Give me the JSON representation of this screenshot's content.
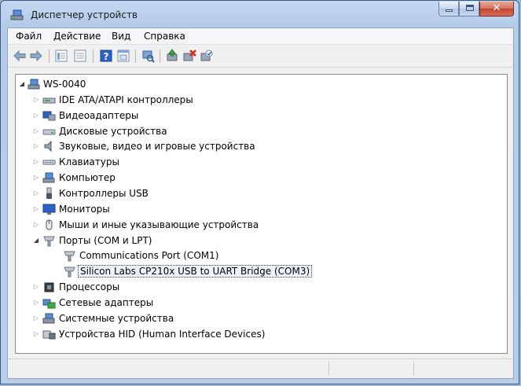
{
  "window": {
    "title": "Диспетчер устройств",
    "close_glyph": "✕"
  },
  "menu": {
    "file": "Файл",
    "action": "Действие",
    "view": "Вид",
    "help": "Справка"
  },
  "toolbar": {
    "icons": [
      "back-arrow-icon",
      "forward-arrow-icon",
      "properties-list-icon",
      "list-view-icon",
      "help-icon",
      "details-view-icon",
      "scan-hardware-icon",
      "update-driver-icon",
      "uninstall-device-icon",
      "disable-device-icon"
    ]
  },
  "tree": {
    "root": "WS-0040",
    "nodes": [
      {
        "label": "IDE ATA/ATAPI контроллеры",
        "icon": "ide-controller-icon"
      },
      {
        "label": "Видеоадаптеры",
        "icon": "display-adapter-icon"
      },
      {
        "label": "Дисковые устройства",
        "icon": "disk-drive-icon"
      },
      {
        "label": "Звуковые, видео и игровые устройства",
        "icon": "speaker-icon"
      },
      {
        "label": "Клавиатуры",
        "icon": "keyboard-icon"
      },
      {
        "label": "Компьютер",
        "icon": "computer-icon"
      },
      {
        "label": "Контроллеры USB",
        "icon": "usb-icon"
      },
      {
        "label": "Мониторы",
        "icon": "monitor-icon"
      },
      {
        "label": "Мыши и иные указывающие устройства",
        "icon": "mouse-icon"
      },
      {
        "label": "Порты (COM и LPT)",
        "icon": "port-icon"
      },
      {
        "label": "Communications Port (COM1)",
        "icon": "port-icon"
      },
      {
        "label": "Silicon Labs CP210x USB to UART Bridge (COM3)",
        "icon": "port-icon"
      },
      {
        "label": "Процессоры",
        "icon": "processor-icon"
      },
      {
        "label": "Сетевые адаптеры",
        "icon": "network-adapter-icon"
      },
      {
        "label": "Системные устройства",
        "icon": "system-device-icon"
      },
      {
        "label": "Устройства HID (Human Interface Devices)",
        "icon": "hid-device-icon"
      }
    ],
    "expander_open": "◢",
    "expander_closed": "▷"
  },
  "colors": {
    "accent": "#3b5a82",
    "selection": "#eef3fb",
    "close_red": "#c0452d"
  }
}
